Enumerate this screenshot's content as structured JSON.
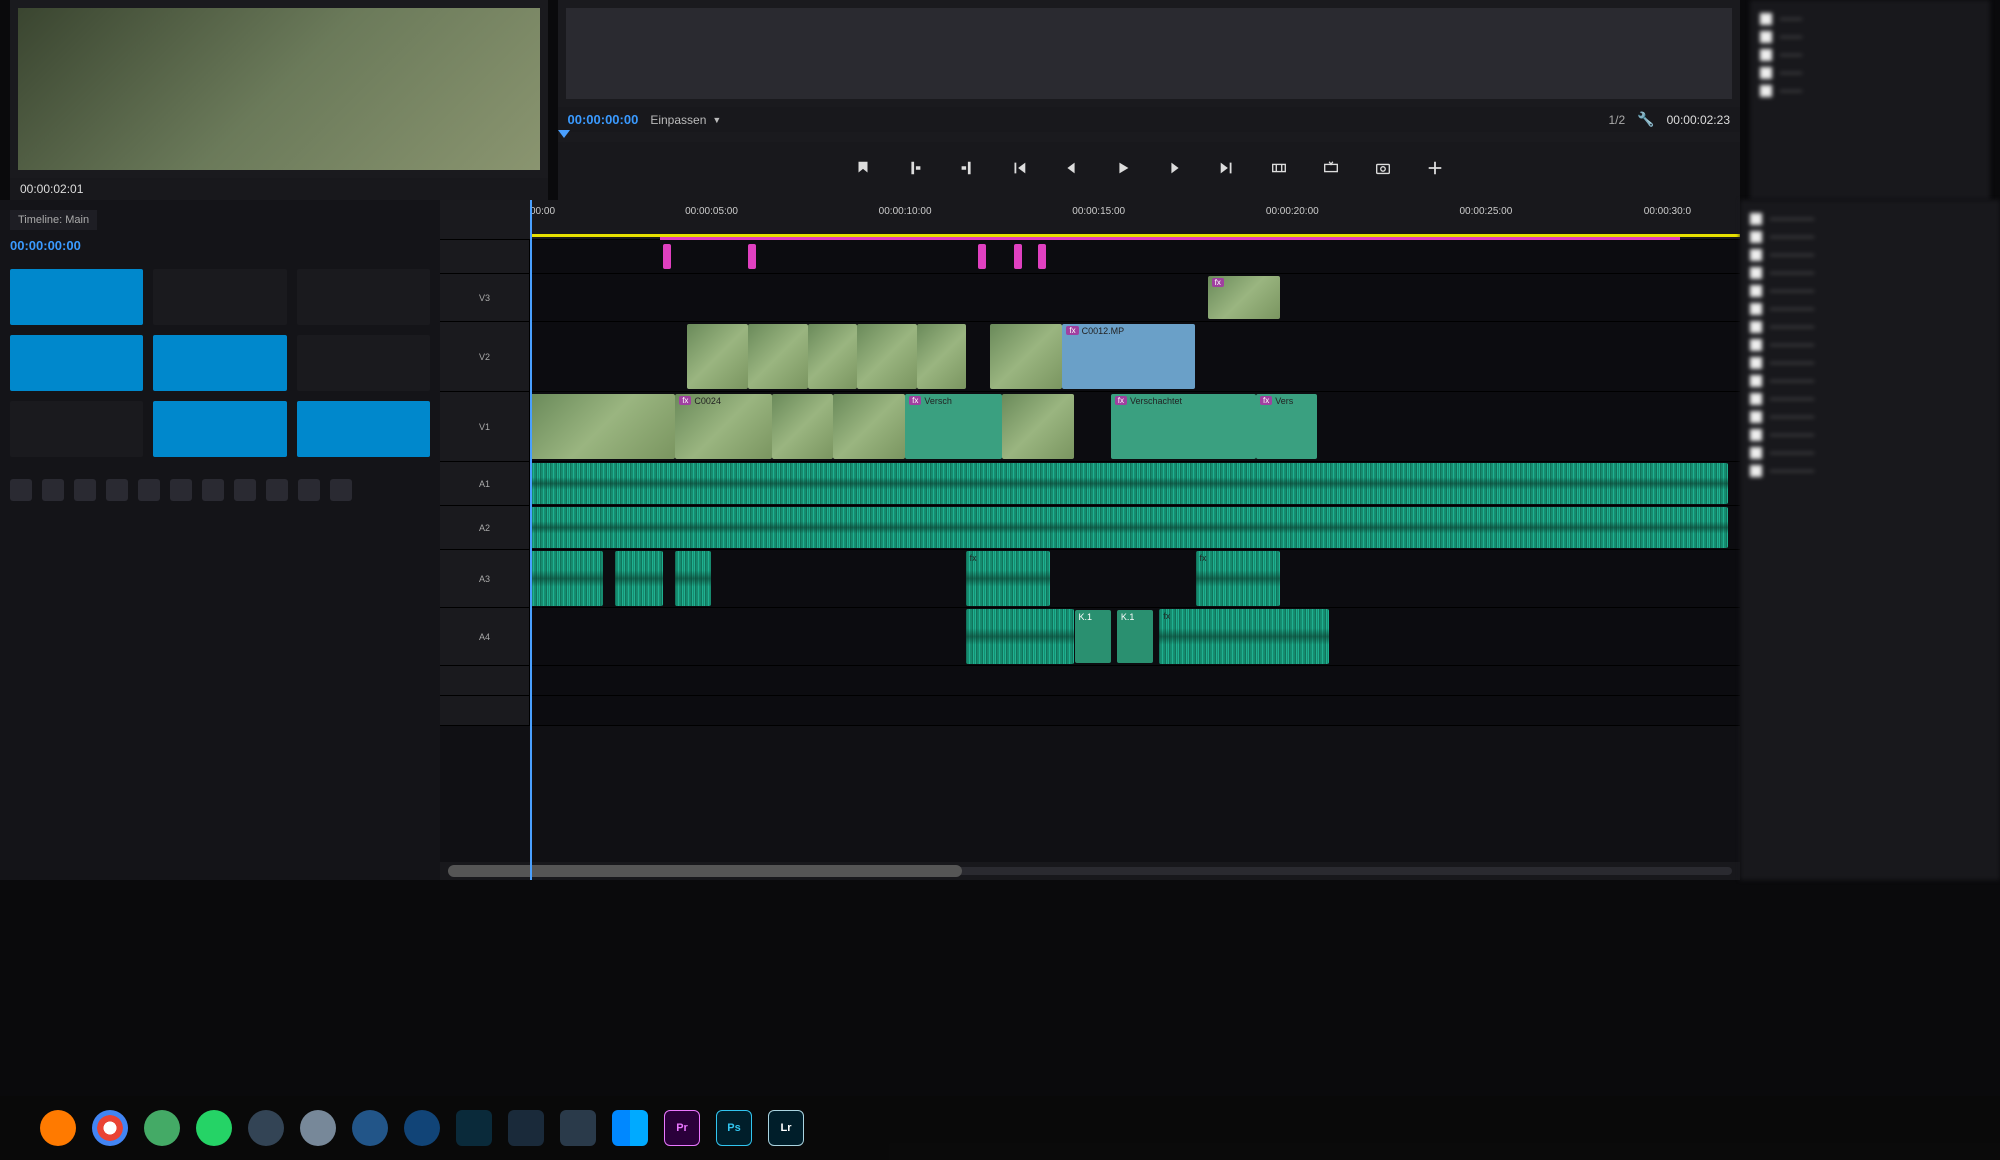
{
  "source_monitor": {
    "timecode": "00:00:02:01"
  },
  "program_monitor": {
    "timecode_position": "00:00:00:00",
    "zoom_dropdown": "Einpassen",
    "zoom_ratio": "1/2",
    "timecode_out": "00:00:02:23"
  },
  "transport": {
    "mark_in": "Mark In",
    "mark_out": "Mark Out",
    "go_in": "Go To In",
    "step_back": "Step Back",
    "play": "Play",
    "step_fwd": "Step Fwd",
    "go_out": "Go To Out",
    "lift": "Lift",
    "extract": "Extract",
    "export_frame": "Export Frame"
  },
  "sequence": {
    "tab_label": "Timeline: Main",
    "playhead": "00:00:00:00"
  },
  "ruler": {
    "ticks": [
      "00:00",
      "00:00:05:00",
      "00:00:10:00",
      "00:00:15:00",
      "00:00:20:00",
      "00:00:25:00",
      "00:00:30:0"
    ]
  },
  "tracks": {
    "v3": "V3",
    "v2": "V2",
    "v1": "V1",
    "a1": "A1",
    "a2": "A2",
    "a3": "A3",
    "a4": "A4"
  },
  "clips": {
    "c0012": "C0012.MP",
    "c0024": "C0024",
    "versch1": "Versch",
    "versch2": "Verschachtet",
    "versch3": "Vers",
    "fx": "fx",
    "k1": "K.1"
  },
  "taskbar": {
    "pr": "Pr",
    "ps": "Ps",
    "lr": "Lr"
  },
  "right_rail": {
    "items": [
      "",
      "",
      "",
      "",
      "",
      "",
      "",
      "",
      "",
      "",
      "",
      "",
      "",
      "",
      "",
      "",
      "",
      "",
      ""
    ]
  }
}
